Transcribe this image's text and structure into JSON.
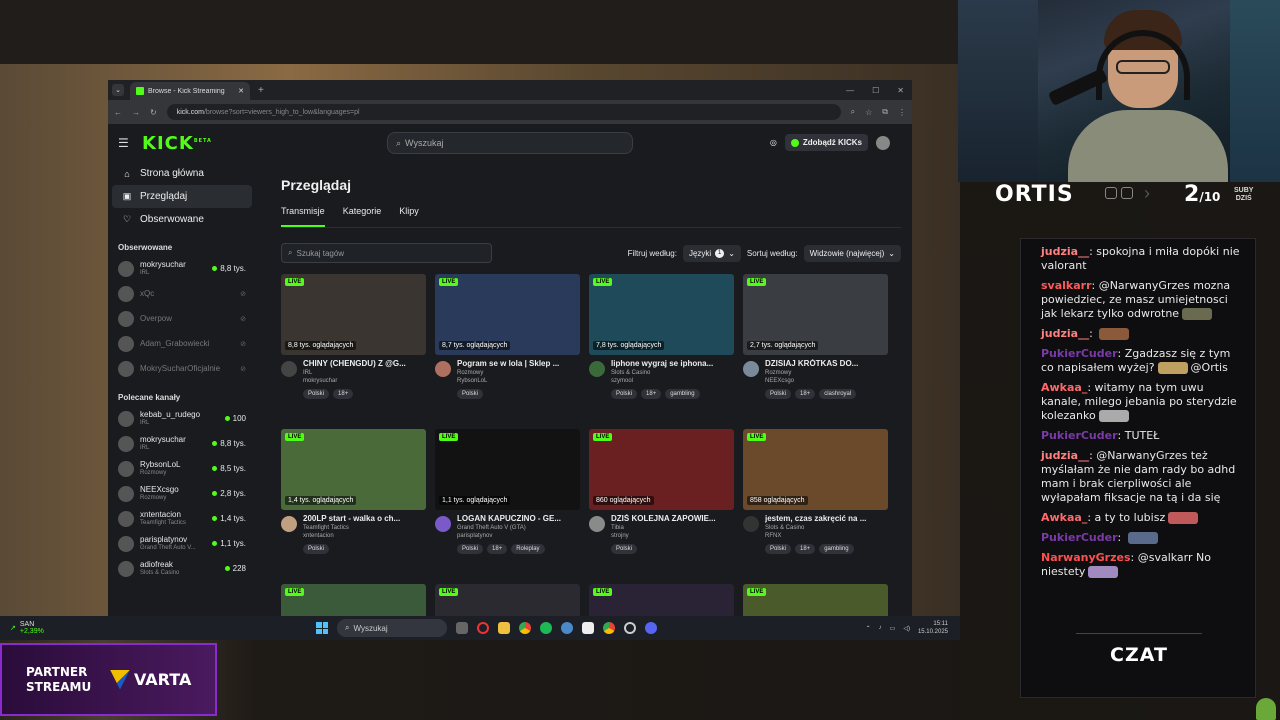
{
  "browser": {
    "tab_title": "Browse - Kick Streaming",
    "url_main": "kick.com",
    "url_rest": "/browse?sort=viewers_high_to_low&languages=pl"
  },
  "kick": {
    "logo": "KICK",
    "logo_badge": "BETA",
    "search_placeholder": "Wyszukaj",
    "get_kicks": "Zdobądź KICKs",
    "nav": [
      {
        "label": "Strona główna",
        "icon": "home-icon"
      },
      {
        "label": "Przeglądaj",
        "icon": "browse-icon"
      },
      {
        "label": "Obserwowane",
        "icon": "heart-icon"
      }
    ],
    "followed_heading": "Obserwowane",
    "followed": [
      {
        "name": "mokrysuchar",
        "category": "IRL",
        "viewers": "8,8 tys.",
        "live": true
      },
      {
        "name": "xQc",
        "category": "",
        "viewers": "",
        "live": false
      },
      {
        "name": "Overpow",
        "category": "",
        "viewers": "",
        "live": false
      },
      {
        "name": "Adam_Grabowiecki",
        "category": "",
        "viewers": "",
        "live": false
      },
      {
        "name": "MokrySucharOficjalnie",
        "category": "",
        "viewers": "",
        "live": false
      }
    ],
    "recommended_heading": "Polecane kanały",
    "recommended": [
      {
        "name": "kebab_u_rudego",
        "category": "IRL",
        "viewers": "100"
      },
      {
        "name": "mokrysuchar",
        "category": "IRL",
        "viewers": "8,8 tys."
      },
      {
        "name": "RybsonLoL",
        "category": "Rozmowy",
        "viewers": "8,5 tys."
      },
      {
        "name": "NEEXcsgo",
        "category": "Rozmowy",
        "viewers": "2,8 tys."
      },
      {
        "name": "xntentacion",
        "category": "Teamfight Tactics",
        "viewers": "1,4 tys."
      },
      {
        "name": "parisplatynov",
        "category": "Grand Theft Auto V...",
        "viewers": "1,1 tys."
      },
      {
        "name": "adiofreak",
        "category": "Slots & Casino",
        "viewers": "228"
      }
    ],
    "page_title": "Przeglądaj",
    "tabs": [
      "Transmisje",
      "Kategorie",
      "Klipy"
    ],
    "tag_search_placeholder": "Szukaj tagów",
    "filter_label": "Filtruj według:",
    "filter_value": "Języki",
    "filter_count": "1",
    "sort_label": "Sortuj według:",
    "sort_value": "Widzowie (najwięcej)",
    "live_label": "LIVE",
    "streams": [
      {
        "viewers": "8,8 tys. oglądających",
        "title": "CHINY (CHENGDU) Z @G...",
        "category": "IRL",
        "channel": "mokrysuchar",
        "tags": [
          "Polski",
          "18+"
        ],
        "thumb": "#3a3530",
        "avatar": "#444"
      },
      {
        "viewers": "8,7 tys. oglądających",
        "title": "Pogram se w lola | Sklep ...",
        "category": "Rozmowy",
        "channel": "RybsonLoL",
        "tags": [
          "Polski"
        ],
        "thumb": "#2a3a5a",
        "avatar": "#b07060"
      },
      {
        "viewers": "7,8 tys. oglądających",
        "title": "Iiphone wygraj se iphona...",
        "category": "Slots & Casino",
        "channel": "szymool",
        "tags": [
          "Polski",
          "18+",
          "gambling"
        ],
        "thumb": "#1e4a5a",
        "avatar": "#3a6a3a"
      },
      {
        "viewers": "2,7 tys. oglądających",
        "title": "DZISIAJ KRÓTKAS DO...",
        "category": "Rozmowy",
        "channel": "NEEXcsgo",
        "tags": [
          "Polski",
          "18+",
          "clashroyal"
        ],
        "thumb": "#3a3d42",
        "avatar": "#7a8a9a"
      },
      {
        "viewers": "1,4 tys. oglądających",
        "title": "200LP start - walka o ch...",
        "category": "Teamfight Tactics",
        "channel": "xntentacion",
        "tags": [
          "Polski"
        ],
        "thumb": "#4a6a3a",
        "avatar": "#c0a080"
      },
      {
        "viewers": "1,1 tys. oglądających",
        "title": "LOGAN KAPUCZINO - GE...",
        "category": "Grand Theft Auto V (GTA)",
        "channel": "parisplatynov",
        "tags": [
          "Polski",
          "18+",
          "Roleplay"
        ],
        "thumb": "#121212",
        "avatar": "#7a5ac8"
      },
      {
        "viewers": "860 oglądających",
        "title": "DZIŚ KOLEJNA ZAPOWIE...",
        "category": "Tibia",
        "channel": "strojny",
        "tags": [
          "Polski"
        ],
        "thumb": "#6a2020",
        "avatar": "#8a8a8a"
      },
      {
        "viewers": "858 oglądających",
        "title": "jestem, czas zakręcić na ...",
        "category": "Slots & Casino",
        "channel": "RFNX",
        "tags": [
          "Polski",
          "18+",
          "gambling"
        ],
        "thumb": "#6a4a2a",
        "avatar": "#333"
      },
      {
        "thumb": "#3a5a3a"
      },
      {
        "thumb": "#2a2a30"
      },
      {
        "thumb": "#2a2235"
      },
      {
        "thumb": "#4a5a2a"
      }
    ]
  },
  "taskbar": {
    "ticker": "SAN",
    "ticker_change": "+2,39%",
    "search": "Wyszukaj",
    "time": "15:11",
    "date": "15.10.2025"
  },
  "overlay": {
    "streamer": "ORTIS",
    "subs_current": "2",
    "subs_goal": "/10",
    "subs_label_1": "SUBY",
    "subs_label_2": "DZIŚ",
    "chat_title": "CZAT",
    "partner_line1": "PARTNER",
    "partner_line2": "STREAMU",
    "brand": "VARTA"
  },
  "chat": [
    {
      "user": "judzia__",
      "color": "#ff8080",
      "text": "spokojna i miła dopóki nie valorant",
      "emote": ""
    },
    {
      "user": "svalkarr",
      "color": "#ff5a5a",
      "text": "@NarwanyGrzes mozna powiedziec, ze masz umiejetnosci jak lekarz tylko odwrotne",
      "emote": "#6a6a50"
    },
    {
      "user": "judzia__",
      "color": "#ff8080",
      "text": "",
      "emote": "#8a5a3a"
    },
    {
      "user": "PukierCuder",
      "color": "#7a3aa8",
      "text": "Zgadzasz się z tym co napisałem wyżej?",
      "emote": "#c0a060"
    },
    {
      "user": "Awkaa_",
      "color": "#ff6a6a",
      "text": "witamy na tym uwu kanale, milego jebania po sterydzie kolezanko",
      "emote": "#aaaaaa"
    },
    {
      "user": "PukierCuder",
      "color": "#7a3aa8",
      "text": "TUTEŁ",
      "emote": ""
    },
    {
      "user": "judzia__",
      "color": "#ff8080",
      "text": "@NarwanyGrzes też myślałam że nie dam rady bo adhd mam i brak cierpliwości ale wyłapałam fiksacje na tą i da się",
      "emote": ""
    },
    {
      "user": "Awkaa_",
      "color": "#ff6a6a",
      "text": "a ty to lubisz",
      "emote": "#c05a5a"
    },
    {
      "user": "PukierCuder",
      "color": "#7a3aa8",
      "text": "",
      "emote": "#5a6a8a"
    },
    {
      "user": "NarwanyGrzes",
      "color": "#ff5050",
      "text": "@svalkarr No niestety",
      "emote": "#a08ac0"
    }
  ],
  "chat_inline_mention": "@Ortis"
}
